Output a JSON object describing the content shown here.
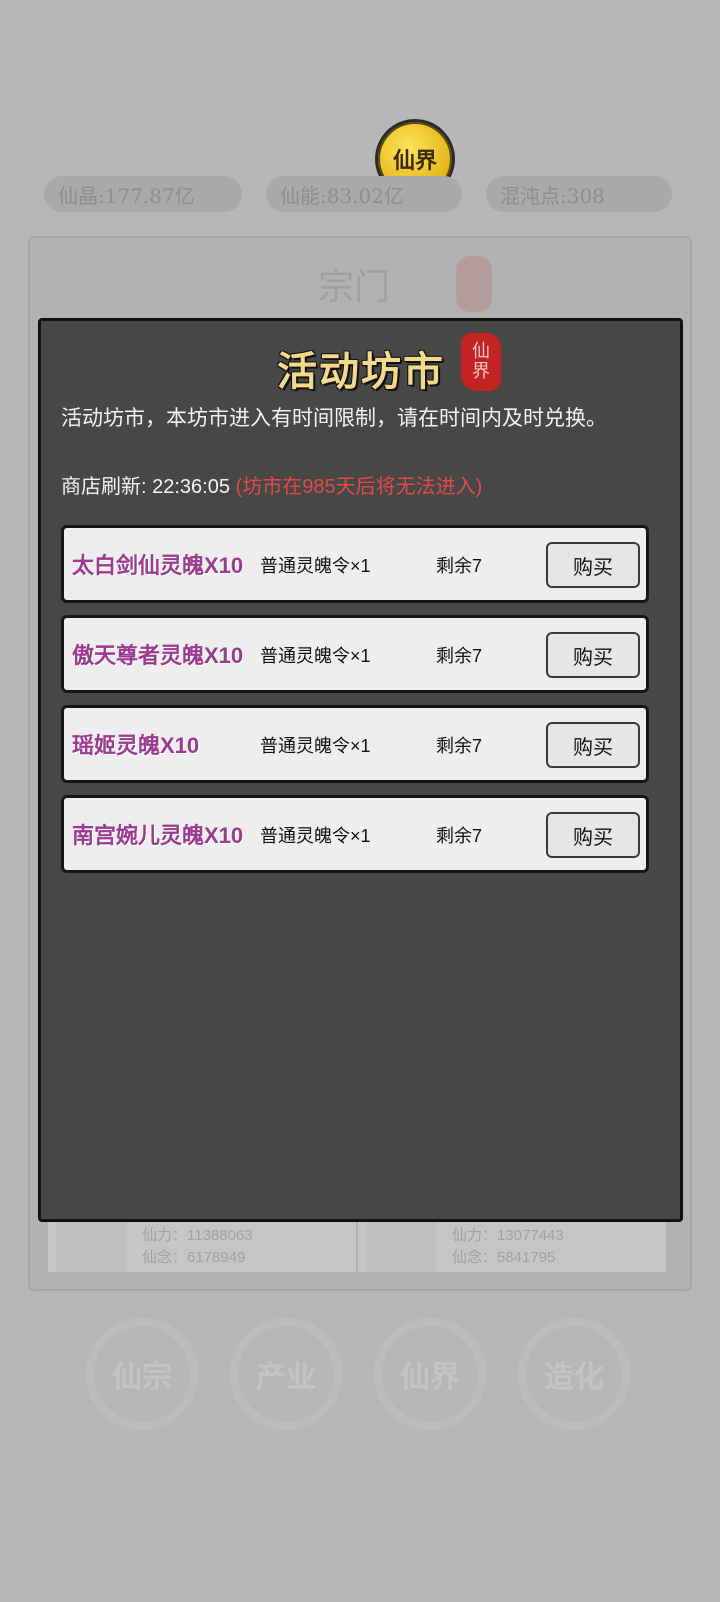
{
  "background": {
    "logo_text": "仙界",
    "resources": [
      "仙晶:177.87亿",
      "仙能:83.02亿",
      "混沌点:308"
    ],
    "section_title": "宗门",
    "cards": [
      {
        "power": "仙力：11388063",
        "mind": "仙念：6178949"
      },
      {
        "power": "仙力：13077443",
        "mind": "仙念：5841795"
      }
    ],
    "bottom_nav": [
      "仙宗",
      "产业",
      "仙界",
      "造化"
    ]
  },
  "modal": {
    "title": "活动坊市",
    "seal_text": "仙界",
    "description": "活动坊市，本坊市进入有时间限制，请在时间内及时兑换。",
    "refresh_label": "商店刷新:",
    "refresh_time": "22:36:05",
    "warning": "(坊市在985天后将无法进入)",
    "items": [
      {
        "name": "太白剑仙灵魄X10",
        "cost": "普通灵魄令×1",
        "remain": "剩余7",
        "button": "购买"
      },
      {
        "name": "傲天尊者灵魄X10",
        "cost": "普通灵魄令×1",
        "remain": "剩余7",
        "button": "购买"
      },
      {
        "name": "瑶姬灵魄X10",
        "cost": "普通灵魄令×1",
        "remain": "剩余7",
        "button": "购买"
      },
      {
        "name": "南宫婉儿灵魄X10",
        "cost": "普通灵魄令×1",
        "remain": "剩余7",
        "button": "购买"
      }
    ]
  }
}
